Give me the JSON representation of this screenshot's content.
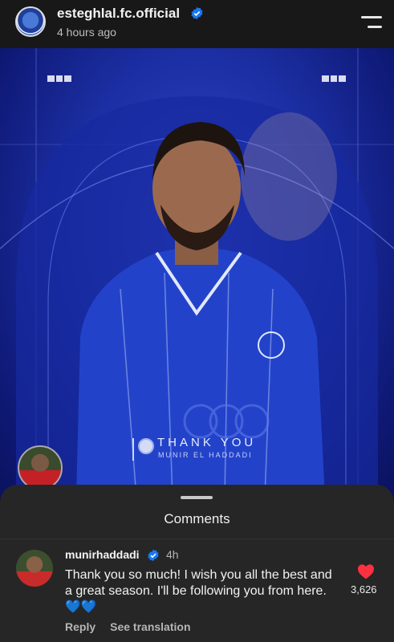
{
  "header": {
    "username": "esteghlal.fc.official",
    "time": "4 hours ago"
  },
  "post": {
    "thank_text": "THANK YOU",
    "player_name": "MUNIR EL HADDADI"
  },
  "comments": {
    "title": "Comments",
    "items": [
      {
        "username": "munirhaddadi",
        "time": "4h",
        "text": "Thank you so much! I wish you all the best and a great season. I'll be following you from here.💙💙",
        "likes": "3,626",
        "reply_label": "Reply",
        "translate_label": "See translation"
      }
    ]
  },
  "colors": {
    "accent_blue": "#1877f2",
    "heart_red": "#ff3040",
    "sheet_bg": "#262626"
  },
  "icons": [
    "verified-badge-icon",
    "menu-icon",
    "heart-icon"
  ]
}
